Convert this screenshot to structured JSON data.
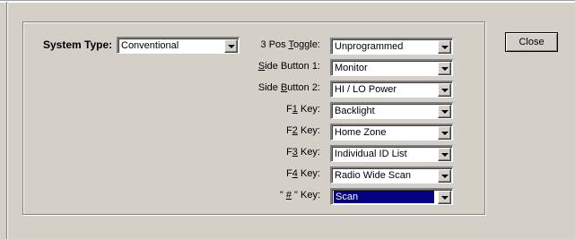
{
  "system_type": {
    "label": "System Type:",
    "value": "Conventional"
  },
  "close_label": "Close",
  "assignments": [
    {
      "label_pre": "3 Pos ",
      "label_ul": "T",
      "label_post": "oggle:",
      "value": "Unprogrammed",
      "selected": false
    },
    {
      "label_pre": "",
      "label_ul": "S",
      "label_post": "ide Button 1:",
      "value": "Monitor",
      "selected": false
    },
    {
      "label_pre": "Side ",
      "label_ul": "B",
      "label_post": "utton 2:",
      "value": "HI / LO Power",
      "selected": false
    },
    {
      "label_pre": "F",
      "label_ul": "1",
      "label_post": " Key:",
      "value": "Backlight",
      "selected": false
    },
    {
      "label_pre": "F",
      "label_ul": "2",
      "label_post": " Key:",
      "value": "Home Zone",
      "selected": false
    },
    {
      "label_pre": "F",
      "label_ul": "3",
      "label_post": " Key:",
      "value": "Individual ID List",
      "selected": false
    },
    {
      "label_pre": "F",
      "label_ul": "4",
      "label_post": " Key:",
      "value": "Radio Wide Scan",
      "selected": false
    },
    {
      "label_pre": "\" ",
      "label_ul": "#",
      "label_post": " \" Key:",
      "value": "Scan",
      "selected": true
    }
  ]
}
